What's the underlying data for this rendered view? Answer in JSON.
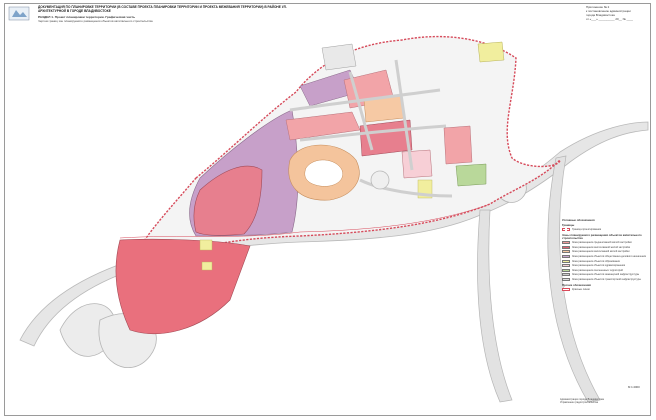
{
  "header": {
    "title": "ДОКУМЕНТАЦИЯ ПО ПЛАНИРОВКЕ ТЕРРИТОРИИ (В СОСТАВЕ ПРОЕКТА ПЛАНИРОВКИ ТЕРРИТОРИИ И ПРОЕКТА МЕЖЕВАНИЯ ТЕРРИТОРИИ) В РАЙОНЕ УЛ. АРХИТЕКТУРНОЙ В ГОРОДЕ ВЛАДИВОСТОКЕ",
    "section": "РАЗДЕЛ 1. Проект планировки территории. Графическая часть",
    "sheet_title": "Чертеж границ зон планируемого размещения объектов капитального строительства"
  },
  "stamp": {
    "line1": "Приложение № 2",
    "line2": "к постановлению администрации",
    "line3": "города Владивостока",
    "line4": "от «___» __________ 20__ № ____"
  },
  "legend": {
    "title": "Условные обозначения",
    "groups": [
      {
        "heading": "Границы",
        "items": [
          {
            "label": "Граница проектирования",
            "color": "#d94a5a"
          }
        ]
      },
      {
        "heading": "Зоны планируемого размещения объектов капитального строительства",
        "items": [
          {
            "label": "Зона размещения среднеэтажной жилой застройки",
            "color": "#ef9a9a"
          },
          {
            "label": "Зона размещения многоэтажной жилой застройки",
            "color": "#e06070"
          },
          {
            "label": "Зона размещения малоэтажной жилой застройки",
            "color": "#f6c9a4"
          },
          {
            "label": "Зона размещения объектов общественно-делового назначения",
            "color": "#c7a9d4"
          },
          {
            "label": "Зона размещения объектов образования",
            "color": "#f1ee9e"
          },
          {
            "label": "Зона размещения объектов здравоохранения",
            "color": "#f7cfd6"
          },
          {
            "label": "Зона размещения озелененных территорий",
            "color": "#b9d89a"
          },
          {
            "label": "Зона размещения объектов инженерной инфраструктуры",
            "color": "#cfcfcf"
          },
          {
            "label": "Зона размещения объектов транспортной инфраструктуры",
            "color": "#dedede"
          }
        ]
      },
      {
        "heading": "Прочие обозначения",
        "items": [
          {
            "label": "Красные линии",
            "color": "#ffffff"
          }
        ]
      }
    ]
  },
  "footer": {
    "line1": "Администрация города Владивостока",
    "line2": "Управление градостроительства"
  },
  "sheet_label": "М 1:2000"
}
